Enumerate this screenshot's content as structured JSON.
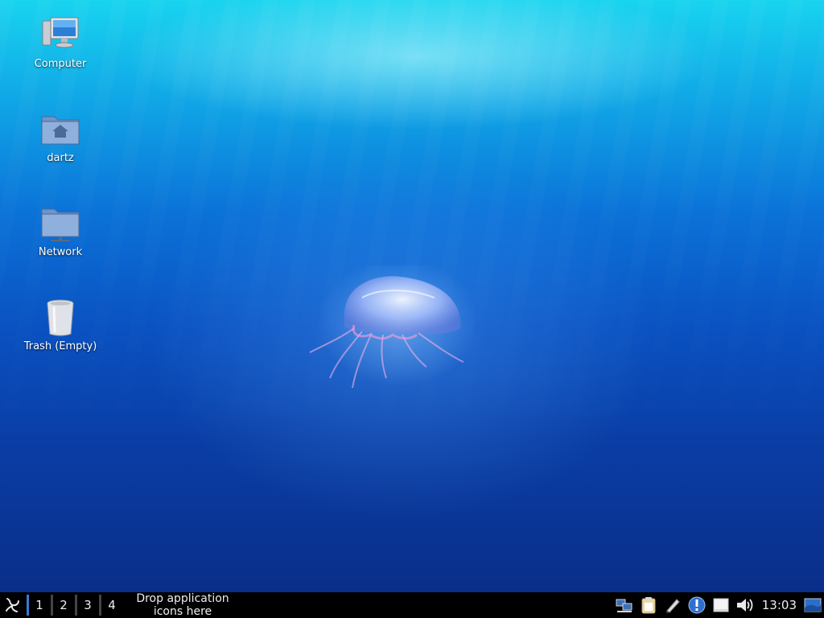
{
  "desktop": {
    "icons": [
      {
        "label": "Computer",
        "icon": "computer-icon"
      },
      {
        "label": "dartz",
        "icon": "home-folder-icon"
      },
      {
        "label": "Network",
        "icon": "network-folder-icon"
      },
      {
        "label": "Trash (Empty)",
        "icon": "trash-icon"
      }
    ]
  },
  "taskbar": {
    "menu_icon": "application-menu-icon",
    "workspaces": [
      "1",
      "2",
      "3",
      "4"
    ],
    "active_workspace": "1",
    "launcher_hint_line1": "Drop application",
    "launcher_hint_line2": "icons here",
    "tray_icons": [
      "network-icon",
      "clipboard-icon",
      "pen-icon",
      "info-icon",
      "removable-drive-icon",
      "volume-icon"
    ],
    "clock": "13:03",
    "show_desktop_icon": "show-desktop-icon"
  },
  "colors": {
    "taskbar_bg": "#000000",
    "active_workspace": "#3a7ad8",
    "desktop_top": "#18d4ef",
    "desktop_bottom": "#0a2e88"
  }
}
